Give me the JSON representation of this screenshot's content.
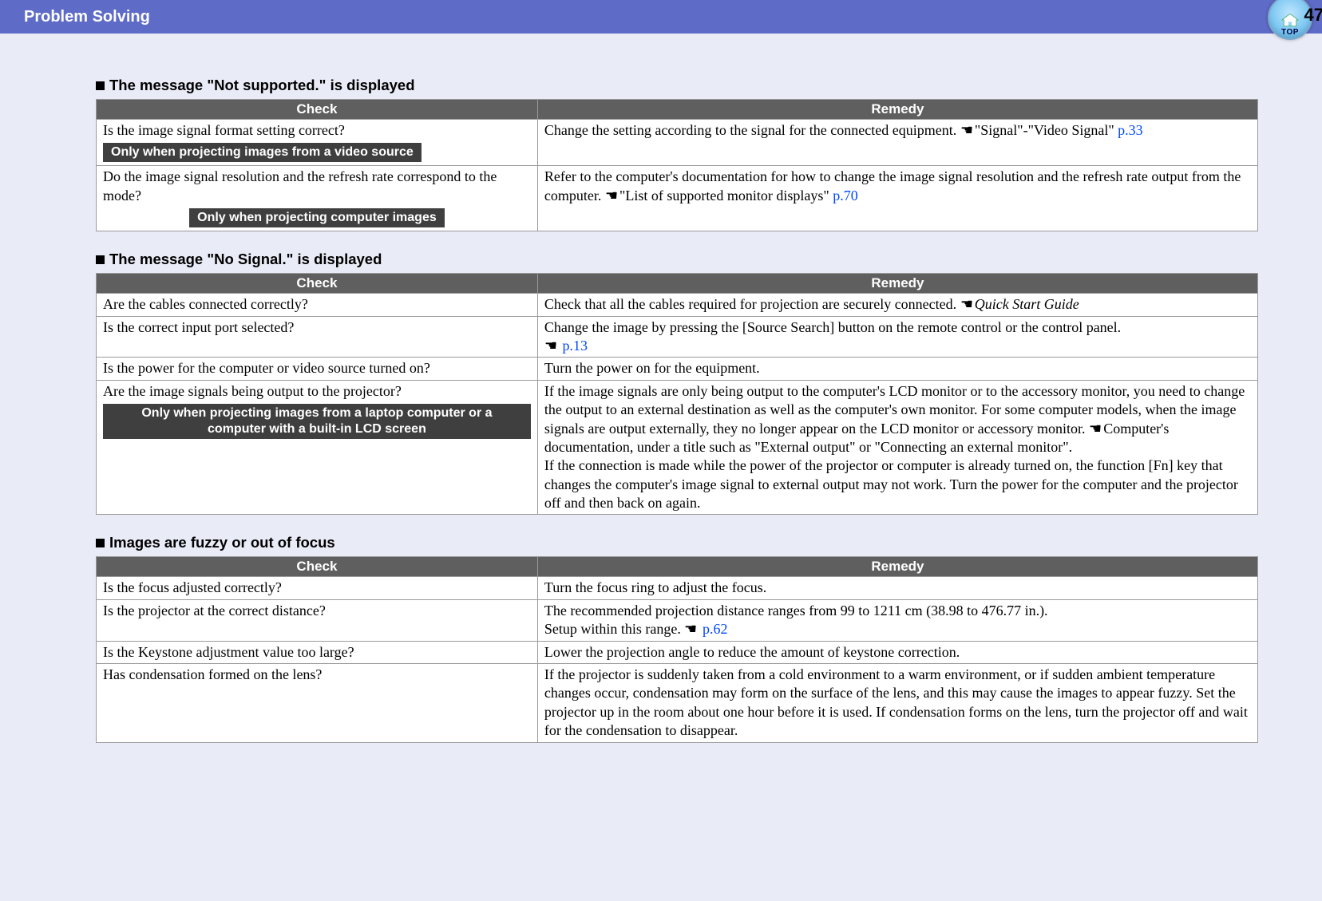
{
  "header": {
    "title": "Problem Solving",
    "page_number": "47",
    "top_label": "TOP"
  },
  "hand_glyph": "☛",
  "sections": [
    {
      "title": "The message \"Not supported.\" is displayed",
      "cols": {
        "check": "Check",
        "remedy": "Remedy"
      },
      "rows": [
        {
          "check": "Is the image signal format setting correct?",
          "condition": "Only when projecting images from a video source",
          "remedy_pre": "Change the setting according to the signal for the connected equipment. ",
          "remedy_ref": "\"Signal\"-\"Video Signal\"  ",
          "remedy_link": "p.33"
        },
        {
          "check": "Do the image signal resolution and the refresh rate correspond to the mode?",
          "condition": "Only when projecting computer images",
          "condition_centered": true,
          "remedy_pre": "Refer to the computer's documentation for how to change the image signal resolution and the refresh rate output from the computer. ",
          "remedy_ref": "\"List of supported monitor displays\" ",
          "remedy_link": "p.70"
        }
      ]
    },
    {
      "title": "The message \"No Signal.\" is displayed",
      "cols": {
        "check": "Check",
        "remedy": "Remedy"
      },
      "rows": [
        {
          "check": "Are the cables connected correctly?",
          "remedy_pre": "Check that all the cables required for projection are securely connected. ",
          "remedy_ital": "Quick Start Guide"
        },
        {
          "check": "Is the correct input port selected?",
          "remedy_pre": "Change the image by pressing the [Source Search] button on the remote control or the control panel.",
          "remedy_link_newline": "p.13"
        },
        {
          "check": "Is the power for the computer or video source turned on?",
          "remedy_pre": "Turn the power on for the equipment."
        },
        {
          "check": "Are the image signals being output to the projector?",
          "condition": "Only when projecting images from a laptop computer or a computer with a built-in LCD screen",
          "condition_centered": true,
          "remedy_pre": "If the image signals are only being output to the computer's LCD monitor or to the accessory monitor, you need to change the output to an external destination as well as the computer's own monitor. For some computer models, when the image signals are output externally, they no longer appear on the LCD monitor or accessory monitor. ",
          "remedy_ref_plain": "Computer's documentation, under a title such as \"External output\" or \"Connecting an external monitor\".",
          "remedy_post": "If the connection is made while the power of the projector or computer is already turned on, the function [Fn] key that changes the computer's image signal to external output may not work. Turn the power for the computer and the projector off and then back on again."
        }
      ]
    },
    {
      "title": "Images are fuzzy or out of focus",
      "cols": {
        "check": "Check",
        "remedy": "Remedy"
      },
      "rows": [
        {
          "check": "Is the focus adjusted correctly?",
          "remedy_pre": "Turn the focus ring to adjust the focus."
        },
        {
          "check": "Is the projector at the correct distance?",
          "remedy_pre": "The recommended projection distance ranges from 99 to 1211 cm (38.98 to 476.77 in.).",
          "remedy_post_inline": "Setup within this range. ",
          "remedy_link": "p.62"
        },
        {
          "check": "Is the Keystone adjustment value too large?",
          "remedy_pre": "Lower the projection angle to reduce the amount of keystone correction."
        },
        {
          "check": "Has condensation formed on the lens?",
          "remedy_pre": "If the projector is suddenly taken from a cold environment to a warm environment, or if sudden ambient temperature changes occur, condensation may form on the surface of the lens, and this may cause the images to appear fuzzy. Set the projector up in the room about one hour before it is used. If condensation forms on the lens, turn the projector off and wait for the condensation to disappear."
        }
      ]
    }
  ]
}
